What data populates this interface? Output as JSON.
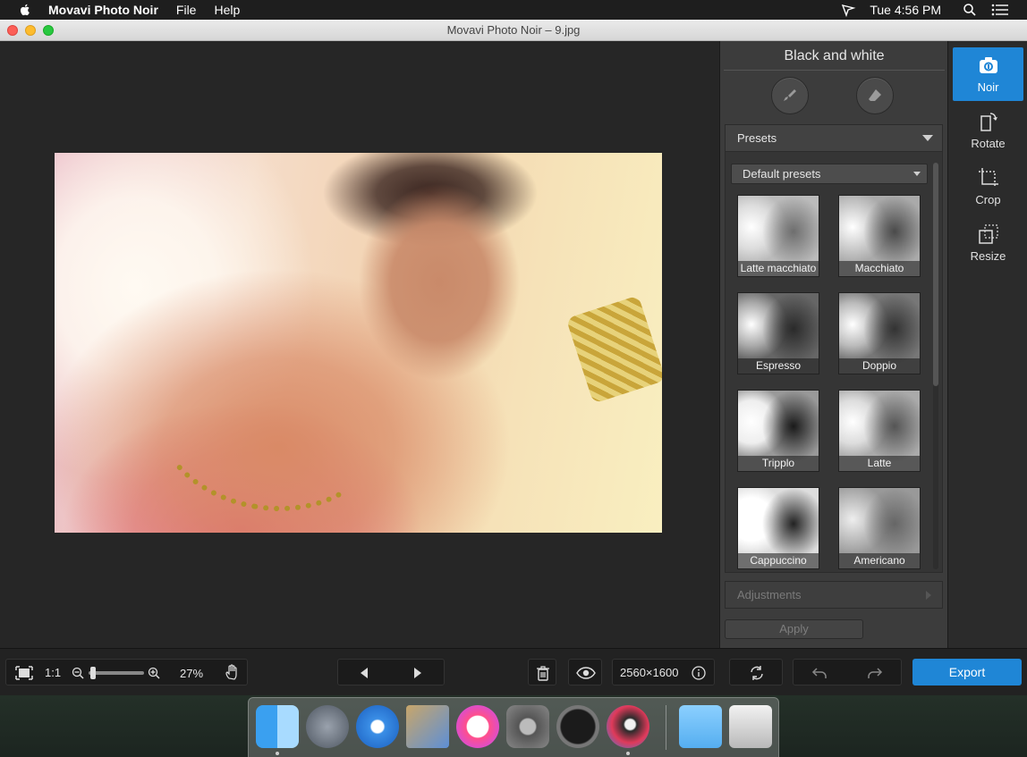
{
  "menubar": {
    "app_name": "Movavi Photo Noir",
    "menus": [
      "File",
      "Help"
    ],
    "clock": "Tue 4:56 PM"
  },
  "window": {
    "title": "Movavi Photo Noir – 9.jpg"
  },
  "panel": {
    "title": "Black and white",
    "presets_header": "Presets",
    "preset_dropdown": "Default presets",
    "presets": [
      {
        "label": "Latte macchiato"
      },
      {
        "label": "Macchiato"
      },
      {
        "label": "Espresso"
      },
      {
        "label": "Doppio"
      },
      {
        "label": "Tripplo"
      },
      {
        "label": "Latte"
      },
      {
        "label": "Cappuccino"
      },
      {
        "label": "Americano"
      }
    ],
    "adjustments_header": "Adjustments",
    "apply_label": "Apply"
  },
  "tools": [
    {
      "label": "Noir",
      "icon": "camera-icon",
      "active": true
    },
    {
      "label": "Rotate",
      "icon": "rotate-icon",
      "active": false
    },
    {
      "label": "Crop",
      "icon": "crop-icon",
      "active": false
    },
    {
      "label": "Resize",
      "icon": "resize-icon",
      "active": false
    }
  ],
  "bottombar": {
    "actual_size_label": "1:1",
    "zoom_percent": "27%",
    "zoom_level": 0.27,
    "dimensions": "2560×1600",
    "export_label": "Export"
  },
  "dock": {
    "apps": [
      "finder-icon",
      "launchpad-icon",
      "safari-icon",
      "mail-icon",
      "itunes-icon",
      "system-preferences-icon",
      "activity-monitor-icon",
      "photo-noir-icon",
      "downloads-folder-icon",
      "trash-icon"
    ]
  },
  "colors": {
    "accent": "#1f86d6",
    "panel_bg": "#3c3c3c",
    "canvas_bg": "#262626"
  }
}
